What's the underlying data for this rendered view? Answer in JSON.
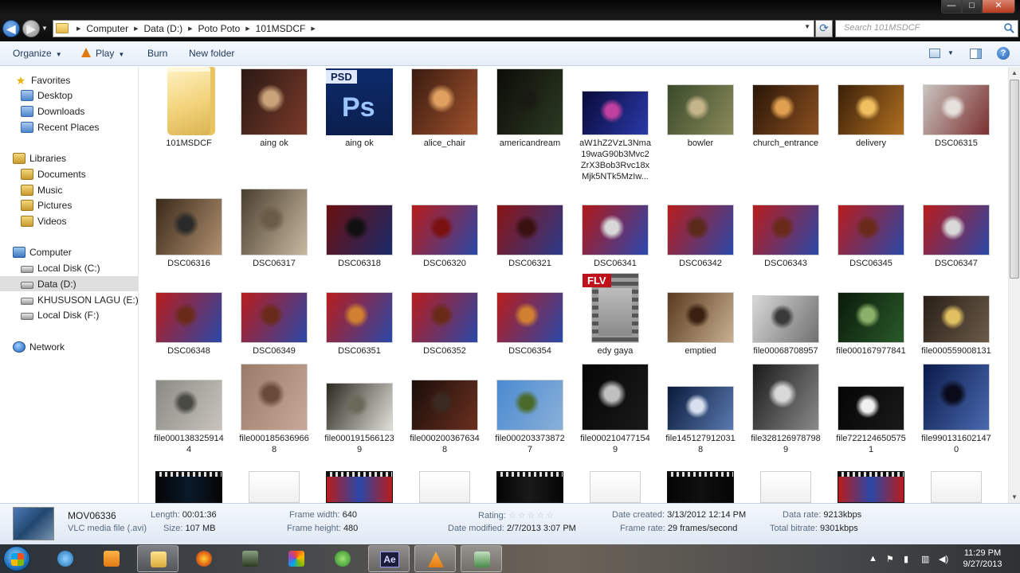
{
  "window": {
    "minimize_label": "—",
    "maximize_label": "□",
    "close_label": "✕"
  },
  "address": {
    "crumbs": [
      "Computer",
      "Data (D:)",
      "Poto Poto",
      "101MSDCF"
    ],
    "search_placeholder": "Search 101MSDCF"
  },
  "toolbar": {
    "organize": "Organize",
    "play": "Play",
    "burn": "Burn",
    "new_folder": "New folder"
  },
  "nav": {
    "favorites": "Favorites",
    "desktop": "Desktop",
    "downloads": "Downloads",
    "recent_places": "Recent Places",
    "libraries": "Libraries",
    "documents": "Documents",
    "music": "Music",
    "pictures": "Pictures",
    "videos": "Videos",
    "computer": "Computer",
    "local_c": "Local Disk (C:)",
    "data_d": "Data (D:)",
    "khususon_e": "KHUSUSON LAGU (E:)",
    "local_f": "Local Disk (F:)",
    "network": "Network"
  },
  "files": [
    {
      "name": "101MSDCF",
      "kind": "folder"
    },
    {
      "name": "aing ok",
      "kind": "photo",
      "colors": [
        "#2a1a14",
        "#7a3a2a",
        "#c9a37a"
      ]
    },
    {
      "name": "aing ok",
      "kind": "psd",
      "badge": "PSD",
      "logo": "Ps"
    },
    {
      "name": "alice_chair",
      "kind": "photo",
      "colors": [
        "#3a1c10",
        "#a0522d",
        "#e0a060"
      ]
    },
    {
      "name": "americandream",
      "kind": "photo",
      "colors": [
        "#0c0c08",
        "#2c3a22",
        "#1a1a14"
      ]
    },
    {
      "name": "aW1hZ2VzL3Nma19waG90b3Mvc2ZrX3Bob3Rvc18xMjk5NTk5MzIw...",
      "display": [
        "aW1hZ2VzL3Nma",
        "19waG90b3Mvc2",
        "ZrX3Bob3Rvc18x",
        "Mjk5NTk5MzIw..."
      ],
      "kind": "photo",
      "colors": [
        "#0a0a3a",
        "#2a3aa8",
        "#c040a0"
      ]
    },
    {
      "name": "bowler",
      "kind": "photo",
      "colors": [
        "#3a4a2a",
        "#8a8a5a",
        "#c4b58a"
      ]
    },
    {
      "name": "church_entrance",
      "kind": "photo",
      "colors": [
        "#2a1608",
        "#8a5020",
        "#e0a050"
      ]
    },
    {
      "name": "delivery",
      "kind": "photo",
      "colors": [
        "#3a200a",
        "#b07020",
        "#f0c060"
      ]
    },
    {
      "name": "DSC06315",
      "kind": "photo",
      "colors": [
        "#c9c4bf",
        "#7a3030",
        "#e6e0dc"
      ]
    },
    {
      "name": "DSC06316",
      "kind": "photo",
      "colors": [
        "#3a2a1a",
        "#b09070",
        "#2a2a2a"
      ]
    },
    {
      "name": "DSC06317",
      "kind": "photo",
      "colors": [
        "#4a4030",
        "#c8b8a0",
        "#6a5a48"
      ]
    },
    {
      "name": "DSC06318",
      "kind": "photo",
      "colors": [
        "#6a1010",
        "#1a2a6a",
        "#101010"
      ]
    },
    {
      "name": "DSC06320",
      "kind": "photo",
      "colors": [
        "#b81c1c",
        "#2a48a8",
        "#7a1010"
      ]
    },
    {
      "name": "DSC06321",
      "kind": "photo",
      "colors": [
        "#8a1414",
        "#2a3a8a",
        "#3a1010"
      ]
    },
    {
      "name": "DSC06341",
      "kind": "photo",
      "colors": [
        "#b01818",
        "#2a48b0",
        "#d8d8d8"
      ]
    },
    {
      "name": "DSC06342",
      "kind": "photo",
      "colors": [
        "#b81c1c",
        "#2a48a8",
        "#5a2a1a"
      ]
    },
    {
      "name": "DSC06343",
      "kind": "photo",
      "colors": [
        "#b81c1c",
        "#2a48a8",
        "#6a2a1a"
      ]
    },
    {
      "name": "DSC06345",
      "kind": "photo",
      "colors": [
        "#b81c1c",
        "#2a48a8",
        "#6a2a1a"
      ]
    },
    {
      "name": "DSC06347",
      "kind": "photo",
      "colors": [
        "#b81c1c",
        "#2a48a8",
        "#d8d8d8"
      ]
    },
    {
      "name": "DSC06348",
      "kind": "photo",
      "colors": [
        "#b81c1c",
        "#2a48a8",
        "#6a2a1a"
      ]
    },
    {
      "name": "DSC06349",
      "kind": "photo",
      "colors": [
        "#b81c1c",
        "#2a48a8",
        "#6a2a1a"
      ]
    },
    {
      "name": "DSC06351",
      "kind": "photo",
      "colors": [
        "#b81c1c",
        "#2a48a8",
        "#d08030"
      ]
    },
    {
      "name": "DSC06352",
      "kind": "photo",
      "colors": [
        "#b81c1c",
        "#2a48a8",
        "#6a2a1a"
      ]
    },
    {
      "name": "DSC06354",
      "kind": "photo",
      "colors": [
        "#b81c1c",
        "#2a48a8",
        "#d08030"
      ]
    },
    {
      "name": "edy gaya",
      "kind": "flv",
      "badge": "FLV"
    },
    {
      "name": "emptied",
      "kind": "photo",
      "colors": [
        "#5a3a20",
        "#c8b090",
        "#3a2010"
      ]
    },
    {
      "name": "file00068708957",
      "kind": "photo",
      "colors": [
        "#d8d8d8",
        "#707070",
        "#3a3a3a"
      ]
    },
    {
      "name": "file000167977841",
      "kind": "photo",
      "colors": [
        "#0a1a0a",
        "#2a5a2a",
        "#8ab06a"
      ]
    },
    {
      "name": "file000559008131",
      "kind": "photo",
      "colors": [
        "#2a2018",
        "#6a5a48",
        "#e0c060"
      ]
    },
    {
      "name": "file0001383259144",
      "display": [
        "file000138325914",
        "4"
      ],
      "kind": "photo",
      "colors": [
        "#8a8a84",
        "#c8c4bc",
        "#4a4a44"
      ]
    },
    {
      "name": "file0001856369668",
      "display": [
        "file000185636966",
        "8"
      ],
      "kind": "photo",
      "colors": [
        "#9a7a68",
        "#c8a898",
        "#6a4a3a"
      ]
    },
    {
      "name": "file0001915661239",
      "display": [
        "file000191566123",
        "9"
      ],
      "kind": "photo",
      "colors": [
        "#2a2a22",
        "#e0e0d8",
        "#6a6a5a"
      ]
    },
    {
      "name": "file0002003676348",
      "display": [
        "file000200367634",
        "8"
      ],
      "kind": "photo",
      "colors": [
        "#1a0e0a",
        "#6a3020",
        "#3a2a20"
      ]
    },
    {
      "name": "file0002033738727",
      "display": [
        "file000203373872",
        "7"
      ],
      "kind": "photo",
      "colors": [
        "#4a8ad0",
        "#8ab0d8",
        "#4a6a2a"
      ]
    },
    {
      "name": "file0002104771549",
      "display": [
        "file000210477154",
        "9"
      ],
      "kind": "photo",
      "colors": [
        "#050505",
        "#1a1a1a",
        "#c0c0c0"
      ]
    },
    {
      "name": "file1451279120318",
      "display": [
        "file145127912031",
        "8"
      ],
      "kind": "photo",
      "colors": [
        "#0a1a3a",
        "#5a7ab0",
        "#d8e0f0"
      ]
    },
    {
      "name": "file3281269787989",
      "display": [
        "file328126978798",
        "9"
      ],
      "kind": "photo",
      "colors": [
        "#1a1a1a",
        "#8a8a8a",
        "#d8d8d8"
      ]
    },
    {
      "name": "file7221246505751",
      "display": [
        "file722124650575",
        "1"
      ],
      "kind": "photo",
      "colors": [
        "#050505",
        "#1a1a1a",
        "#f0f0f0"
      ]
    },
    {
      "name": "file9901316021470",
      "display": [
        "file990131602147",
        "0"
      ],
      "kind": "photo",
      "colors": [
        "#0a1a4a",
        "#4a6ab0",
        "#0a0a1a"
      ]
    },
    {
      "name": "",
      "kind": "video",
      "colors": [
        "#050505",
        "#0a1a2a"
      ]
    },
    {
      "name": "",
      "kind": "blank"
    },
    {
      "name": "",
      "kind": "video",
      "colors": [
        "#b81c1c",
        "#2a48a8"
      ]
    },
    {
      "name": "",
      "kind": "blank"
    },
    {
      "name": "",
      "kind": "video",
      "colors": [
        "#050505",
        "#1a1a1a"
      ]
    },
    {
      "name": "",
      "kind": "blank"
    },
    {
      "name": "",
      "kind": "video",
      "colors": [
        "#050505",
        "#101010"
      ]
    },
    {
      "name": "",
      "kind": "blank"
    },
    {
      "name": "",
      "kind": "video",
      "colors": [
        "#b81c1c",
        "#2a48a8"
      ]
    },
    {
      "name": "",
      "kind": "blank"
    }
  ],
  "details": {
    "name": "MOV06336",
    "type": "VLC media file (.avi)",
    "length_label": "Length:",
    "length_value": "00:01:36",
    "size_label": "Size:",
    "size_value": "107 MB",
    "frame_width_label": "Frame width:",
    "frame_width_value": "640",
    "frame_height_label": "Frame height:",
    "frame_height_value": "480",
    "rating_label": "Rating:",
    "rating_stars": "☆☆☆☆☆",
    "date_modified_label": "Date modified:",
    "date_modified_value": "2/7/2013 3:07 PM",
    "date_created_label": "Date created:",
    "date_created_value": "3/13/2012 12:14 PM",
    "frame_rate_label": "Frame rate:",
    "frame_rate_value": "29 frames/second",
    "data_rate_label": "Data rate:",
    "data_rate_value": "9213kbps",
    "total_bitrate_label": "Total bitrate:",
    "total_bitrate_value": "9301kbps"
  },
  "taskbar": {
    "ae_label": "Ae",
    "time": "11:29 PM",
    "date": "9/27/2013",
    "tray_arrow": "▲"
  }
}
